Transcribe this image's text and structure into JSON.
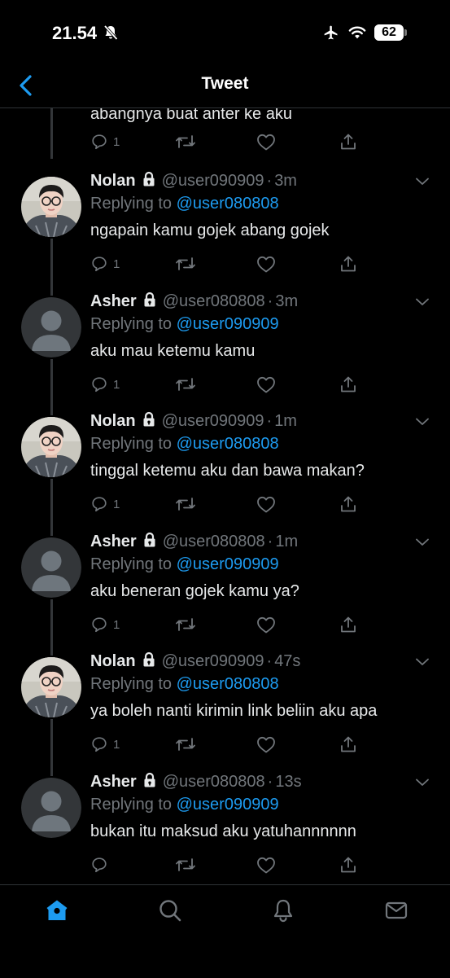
{
  "status_bar": {
    "time": "21.54",
    "battery": "62",
    "battery_fraction": 0.62
  },
  "nav": {
    "title": "Tweet"
  },
  "partial_tweet": {
    "text": "abangnya buat anter ke aku",
    "reply_count": "1"
  },
  "tweets": [
    {
      "name": "Nolan",
      "handle": "@user090909",
      "sep": "·",
      "time": "3m",
      "replying_prefix": "Replying to",
      "replying_to": "@user080808",
      "text": "ngapain kamu gojek abang gojek",
      "reply_count": "1",
      "avatar": "photo"
    },
    {
      "name": "Asher",
      "handle": "@user080808",
      "sep": "·",
      "time": "3m",
      "replying_prefix": "Replying to",
      "replying_to": "@user090909",
      "text": "aku mau ketemu kamu",
      "reply_count": "1",
      "avatar": "default"
    },
    {
      "name": "Nolan",
      "handle": "@user090909",
      "sep": "·",
      "time": "1m",
      "replying_prefix": "Replying to",
      "replying_to": "@user080808",
      "text": "tinggal ketemu aku dan bawa makan?",
      "reply_count": "1",
      "avatar": "photo"
    },
    {
      "name": "Asher",
      "handle": "@user080808",
      "sep": "·",
      "time": "1m",
      "replying_prefix": "Replying to",
      "replying_to": "@user090909",
      "text": "aku beneran gojek kamu ya?",
      "reply_count": "1",
      "avatar": "default"
    },
    {
      "name": "Nolan",
      "handle": "@user090909",
      "sep": "·",
      "time": "47s",
      "replying_prefix": "Replying to",
      "replying_to": "@user080808",
      "text": "ya boleh nanti kirimin link beliin aku apa",
      "reply_count": "1",
      "avatar": "photo"
    },
    {
      "name": "Asher",
      "handle": "@user080808",
      "sep": "·",
      "time": "13s",
      "replying_prefix": "Replying to",
      "replying_to": "@user090909",
      "text": "bukan itu maksud aku yatuhannnnnn",
      "reply_count": "",
      "avatar": "default"
    }
  ],
  "icons": {
    "back": "chevron-left-icon",
    "lock": "lock-icon",
    "more": "chevron-down-icon",
    "reply": "reply-icon",
    "retweet": "retweet-icon",
    "like": "heart-icon",
    "share": "share-icon",
    "tabs": [
      "home-icon",
      "search-icon",
      "notifications-icon",
      "messages-icon"
    ]
  },
  "colors": {
    "background": "#000000",
    "accent": "#1d9bf0",
    "muted": "#71767b",
    "text": "#e7e9ea",
    "divider": "#2f3336"
  }
}
